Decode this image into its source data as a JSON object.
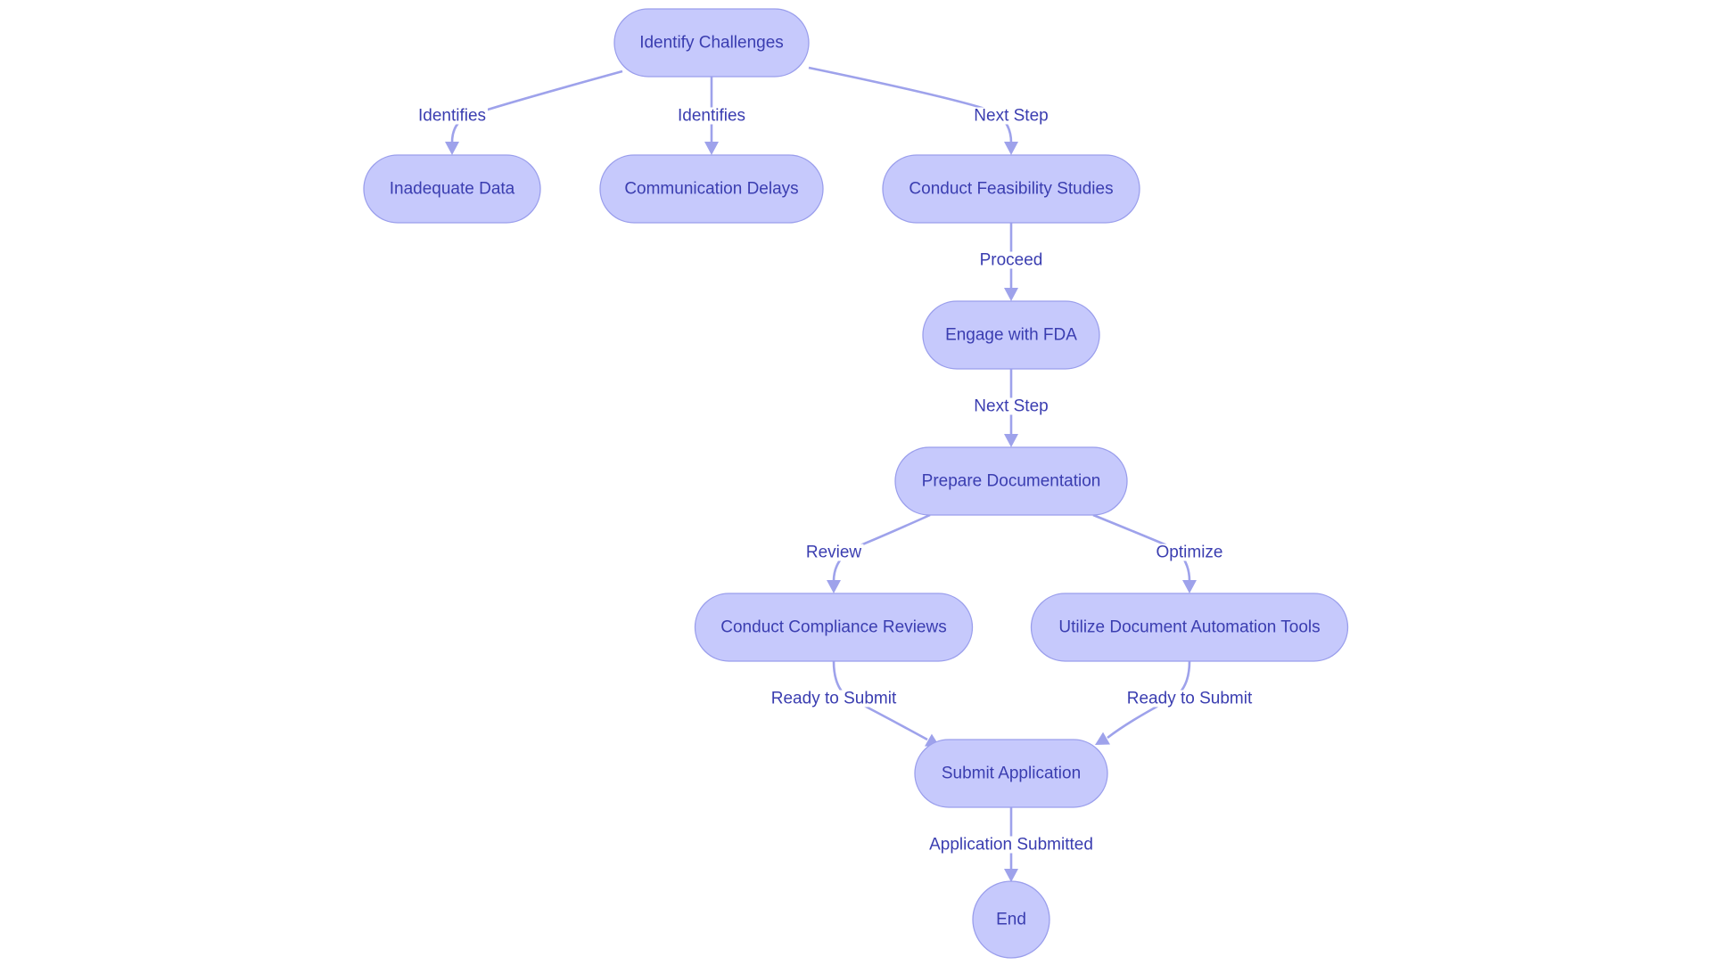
{
  "diagram": {
    "type": "flowchart",
    "direction": "top-down",
    "colors": {
      "node_fill": "#C6C9FC",
      "node_border": "#9A9EEC",
      "text": "#3A3DB0",
      "edge": "#9EA2EB"
    },
    "nodes": [
      {
        "id": "identify",
        "label": "Identify Challenges",
        "shape": "stadium"
      },
      {
        "id": "inadequate",
        "label": "Inadequate Data",
        "shape": "stadium"
      },
      {
        "id": "communication",
        "label": "Communication Delays",
        "shape": "stadium"
      },
      {
        "id": "feasibility",
        "label": "Conduct Feasibility Studies",
        "shape": "stadium"
      },
      {
        "id": "engage",
        "label": "Engage with FDA",
        "shape": "stadium"
      },
      {
        "id": "prepare",
        "label": "Prepare Documentation",
        "shape": "stadium"
      },
      {
        "id": "compliance",
        "label": "Conduct Compliance Reviews",
        "shape": "stadium"
      },
      {
        "id": "automation",
        "label": "Utilize Document Automation Tools",
        "shape": "stadium"
      },
      {
        "id": "submit",
        "label": "Submit Application",
        "shape": "stadium"
      },
      {
        "id": "end",
        "label": "End",
        "shape": "circle"
      }
    ],
    "edges": [
      {
        "from": "identify",
        "to": "inadequate",
        "label": "Identifies"
      },
      {
        "from": "identify",
        "to": "communication",
        "label": "Identifies"
      },
      {
        "from": "identify",
        "to": "feasibility",
        "label": "Next Step"
      },
      {
        "from": "feasibility",
        "to": "engage",
        "label": "Proceed"
      },
      {
        "from": "engage",
        "to": "prepare",
        "label": "Next Step"
      },
      {
        "from": "prepare",
        "to": "compliance",
        "label": "Review"
      },
      {
        "from": "prepare",
        "to": "automation",
        "label": "Optimize"
      },
      {
        "from": "compliance",
        "to": "submit",
        "label": "Ready to Submit"
      },
      {
        "from": "automation",
        "to": "submit",
        "label": "Ready to Submit"
      },
      {
        "from": "submit",
        "to": "end",
        "label": "Application Submitted"
      }
    ]
  }
}
